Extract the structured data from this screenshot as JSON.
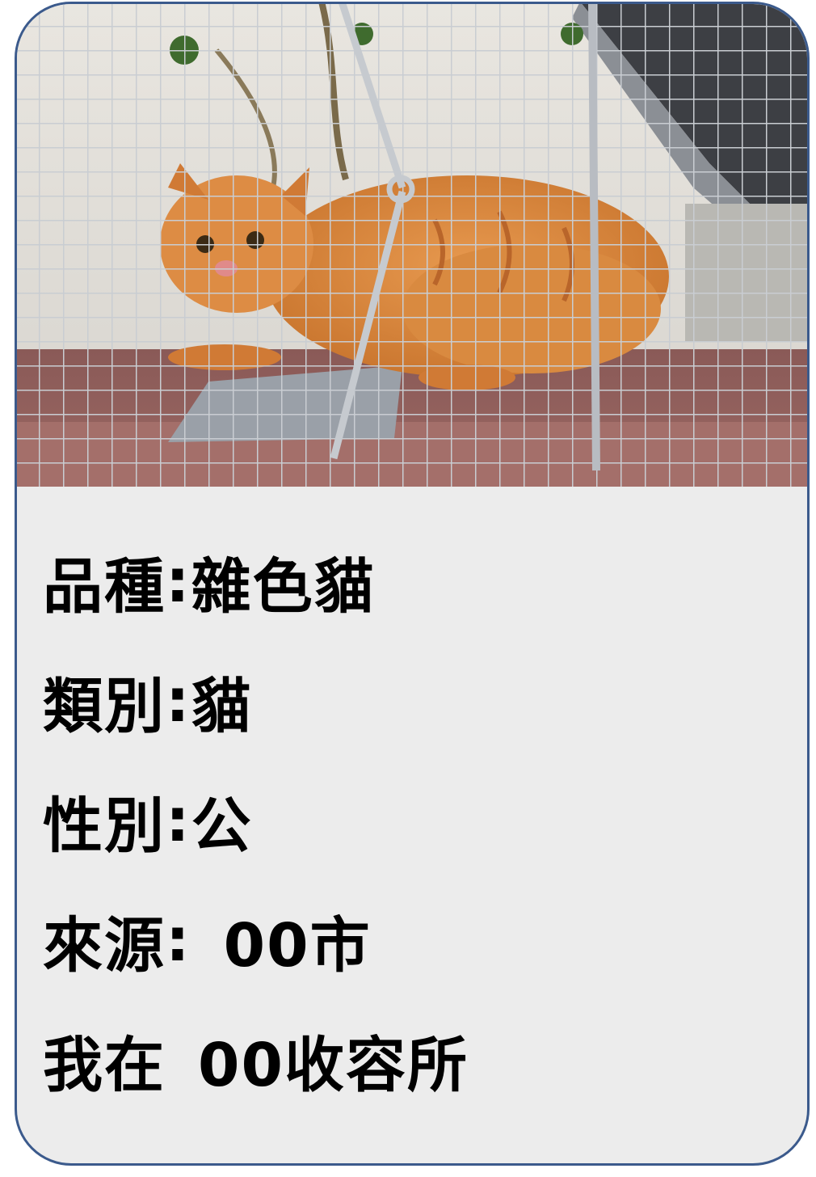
{
  "photo": {
    "subject": "orange tabby cat in wire trap cage",
    "icon": "cat-photo"
  },
  "info": {
    "breed_label": "品種",
    "breed_value": "雜色貓",
    "category_label": "類別",
    "category_value": "貓",
    "sex_label": "性別",
    "sex_value": "公",
    "source_label": "來源",
    "source_value": "00市",
    "location_label": "我在",
    "location_value": "00收容所",
    "colon": ":",
    "colon_full": ":"
  },
  "colors": {
    "border": "#3b5a8c",
    "panel": "#ececec",
    "text": "#000000",
    "cat": "#d9823a"
  }
}
